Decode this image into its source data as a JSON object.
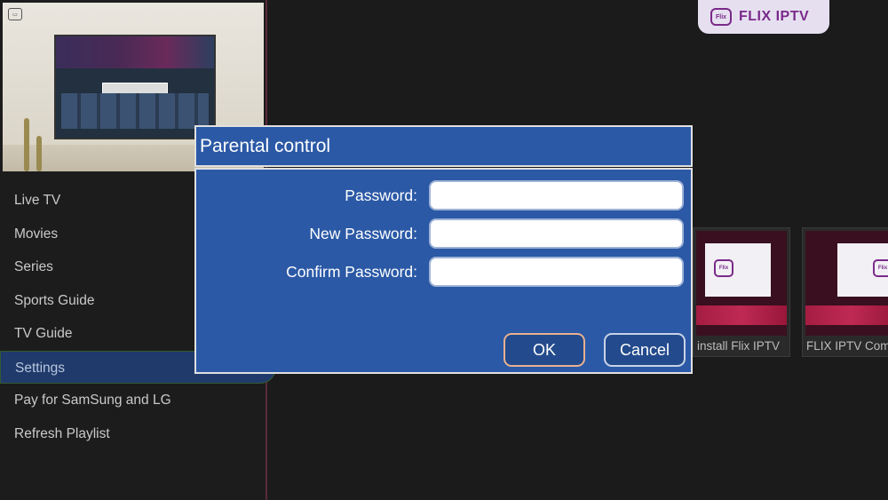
{
  "sidebar": {
    "items": [
      {
        "label": "Live TV"
      },
      {
        "label": "Movies"
      },
      {
        "label": "Series"
      },
      {
        "label": "Sports Guide"
      },
      {
        "label": "TV Guide"
      },
      {
        "label": "Settings",
        "active": true
      },
      {
        "label": "Pay for SamSung and LG"
      },
      {
        "label": "Refresh Playlist"
      }
    ]
  },
  "brand": {
    "icon_label": "Flix",
    "text": "FLIX IPTV"
  },
  "tiles": [
    {
      "caption": "install Flix IPTV",
      "logo": "Flix"
    },
    {
      "caption": "FLIX IPTV Com",
      "logo": "Flix"
    }
  ],
  "dialog": {
    "title": "Parental control",
    "fields": [
      {
        "label": "Password:",
        "value": ""
      },
      {
        "label": "New Password:",
        "value": ""
      },
      {
        "label": "Confirm Password:",
        "value": ""
      }
    ],
    "ok_label": "OK",
    "cancel_label": "Cancel"
  },
  "colors": {
    "dialog_bg": "#2b59a6",
    "active_menu_bg": "#1f3a6b",
    "brand": "#7a2a8a"
  }
}
